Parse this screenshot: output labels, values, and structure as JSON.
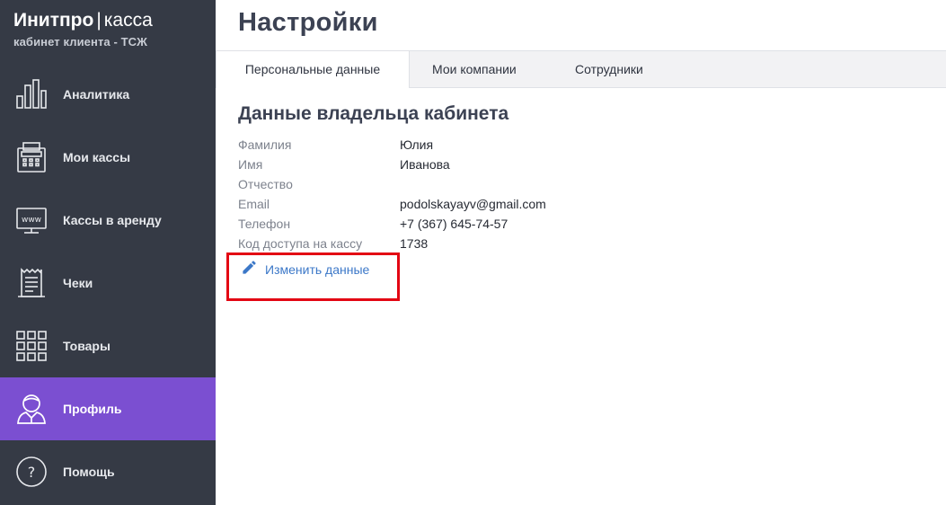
{
  "brand": {
    "name_bold": "Инитпро",
    "separator": "|",
    "name_light": "касса",
    "subtitle": "кабинет клиента - ТСЖ"
  },
  "nav": [
    {
      "label": "Аналитика",
      "icon": "bar-chart-icon",
      "active": false
    },
    {
      "label": "Мои кассы",
      "icon": "cash-register-icon",
      "active": false
    },
    {
      "label": "Кассы в аренду",
      "icon": "www-monitor-icon",
      "active": false
    },
    {
      "label": "Чеки",
      "icon": "receipt-icon",
      "active": false
    },
    {
      "label": "Товары",
      "icon": "grid-icon",
      "active": false
    },
    {
      "label": "Профиль",
      "icon": "user-icon",
      "active": true
    },
    {
      "label": "Помощь",
      "icon": "help-icon",
      "active": false
    }
  ],
  "page": {
    "title": "Настройки"
  },
  "tabs": [
    {
      "label": "Персональные данные",
      "active": true
    },
    {
      "label": "Мои компании",
      "active": false
    },
    {
      "label": "Сотрудники",
      "active": false
    }
  ],
  "owner": {
    "section_title": "Данные владельца кабинета",
    "fields": [
      {
        "label": "Фамилия",
        "value": "Юлия"
      },
      {
        "label": "Имя",
        "value": "Иванова"
      },
      {
        "label": "Отчество",
        "value": ""
      },
      {
        "label": "Email",
        "value": "podolskayayv@gmail.com"
      },
      {
        "label": "Телефон",
        "value": "+7 (367) 645-74-57"
      },
      {
        "label": "Код доступа на кассу",
        "value": "1738"
      }
    ],
    "edit_label": "Изменить данные",
    "edit_icon": "pencil-icon"
  },
  "colors": {
    "sidebar_bg": "#353a45",
    "active_nav": "#7b4fd1",
    "link": "#3c78c8",
    "highlight": "#e30613"
  }
}
